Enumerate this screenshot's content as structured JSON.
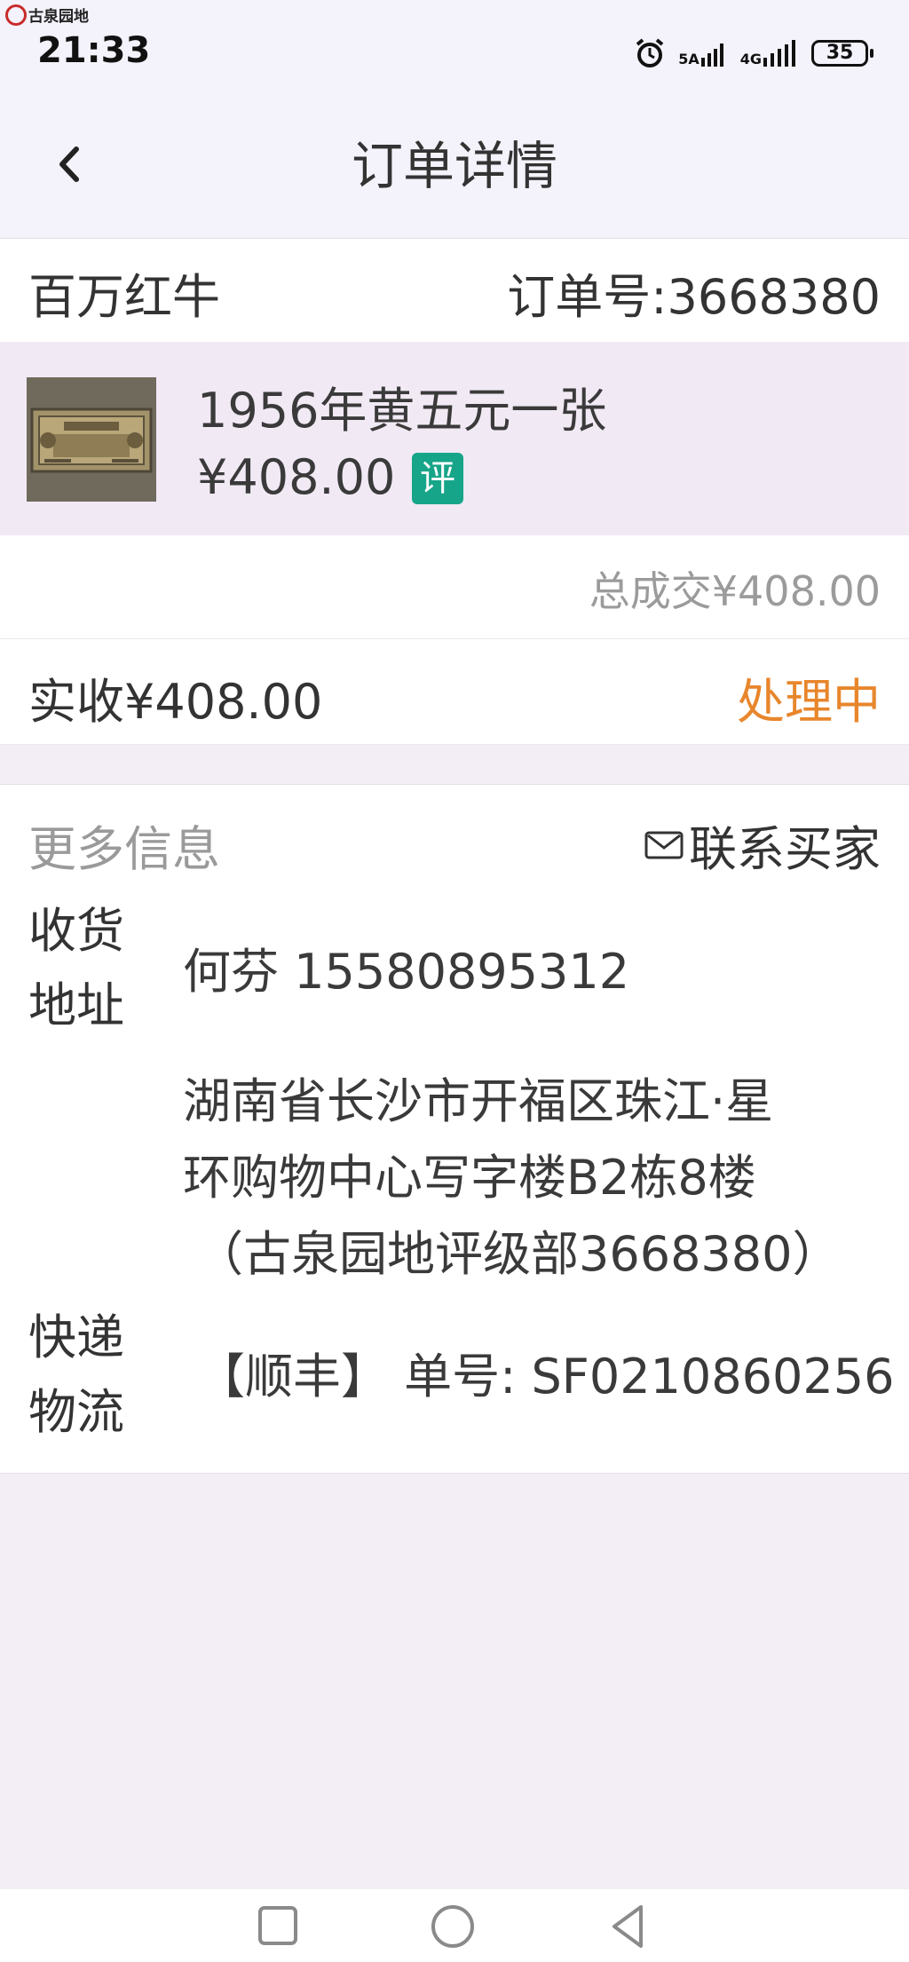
{
  "status_bar": {
    "app_name": "古泉园地",
    "time": "21:33",
    "network1": "5A",
    "network2": "4G",
    "battery": "35"
  },
  "header": {
    "title": "订单详情",
    "back_icon": "chevron-left-icon"
  },
  "order": {
    "shop_name": "百万红牛",
    "order_number": "订单号:3668380"
  },
  "item": {
    "name": "1956年黄五元一张",
    "price": "¥408.00",
    "tag": "评"
  },
  "summary": {
    "total": "总成交¥408.00",
    "received": "实收¥408.00",
    "status": "处理中",
    "status_color": "#e8862c"
  },
  "more_info": {
    "title": "更多信息",
    "contact_label": "联系买家",
    "address_label_line1": "收货",
    "address_label_line2": "地址",
    "recipient": "何芬 15580895312",
    "address_line1": "湖南省长沙市开福区珠江·星",
    "address_line2": "环购物中心写字楼B2栋8楼",
    "address_line3": "（古泉园地评级部3668380）",
    "shipping_label_line1": "快递",
    "shipping_label_line2": "物流",
    "shipping_info": "【顺丰】 单号: SF0210860256"
  },
  "colors": {
    "accent_tag": "#17a589",
    "background": "#f3edf5"
  }
}
